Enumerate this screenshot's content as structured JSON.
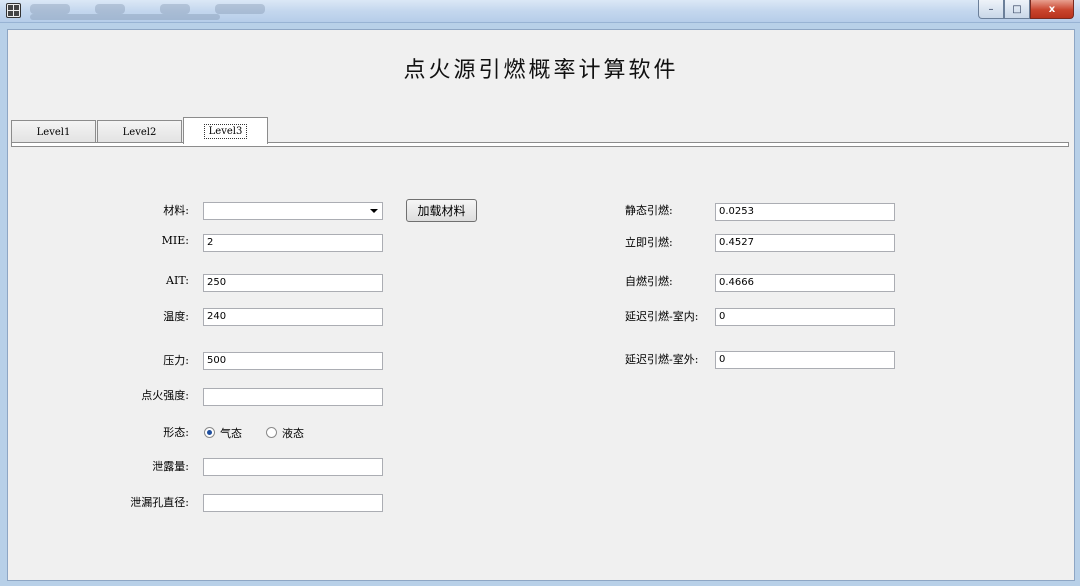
{
  "window": {
    "app_title": "点火源引燃概率计算软件",
    "controls": {
      "minimize": "–",
      "maximize": "□",
      "close": "x"
    }
  },
  "tabs": [
    {
      "label": "Level1",
      "active": false
    },
    {
      "label": "Level2",
      "active": false
    },
    {
      "label": "Level3",
      "active": true
    }
  ],
  "form": {
    "material": {
      "label": "材料:",
      "value": ""
    },
    "load_button": "加载材料",
    "mie": {
      "label": "MIE:",
      "value": "2"
    },
    "ait": {
      "label": "AIT:",
      "value": "250"
    },
    "temperature": {
      "label": "温度:",
      "value": "240"
    },
    "pressure": {
      "label": "压力:",
      "value": "500"
    },
    "ignition_strength": {
      "label": "点火强度:",
      "value": ""
    },
    "state": {
      "label": "形态:",
      "options": [
        "气态",
        "液态"
      ],
      "selected": "气态"
    },
    "leak_amount": {
      "label": "泄露量:",
      "value": ""
    },
    "leak_diameter": {
      "label": "泄漏孔直径:",
      "value": ""
    }
  },
  "results": {
    "static_ignition": {
      "label": "静态引燃:",
      "value": "0.0253"
    },
    "immediate_ignition": {
      "label": "立即引燃:",
      "value": "0.4527"
    },
    "auto_ignition": {
      "label": "自燃引燃:",
      "value": "0.4666"
    },
    "delayed_indoor": {
      "label": "延迟引燃-室内:",
      "value": "0"
    },
    "delayed_outdoor": {
      "label": "延迟引燃-室外:",
      "value": "0"
    }
  }
}
